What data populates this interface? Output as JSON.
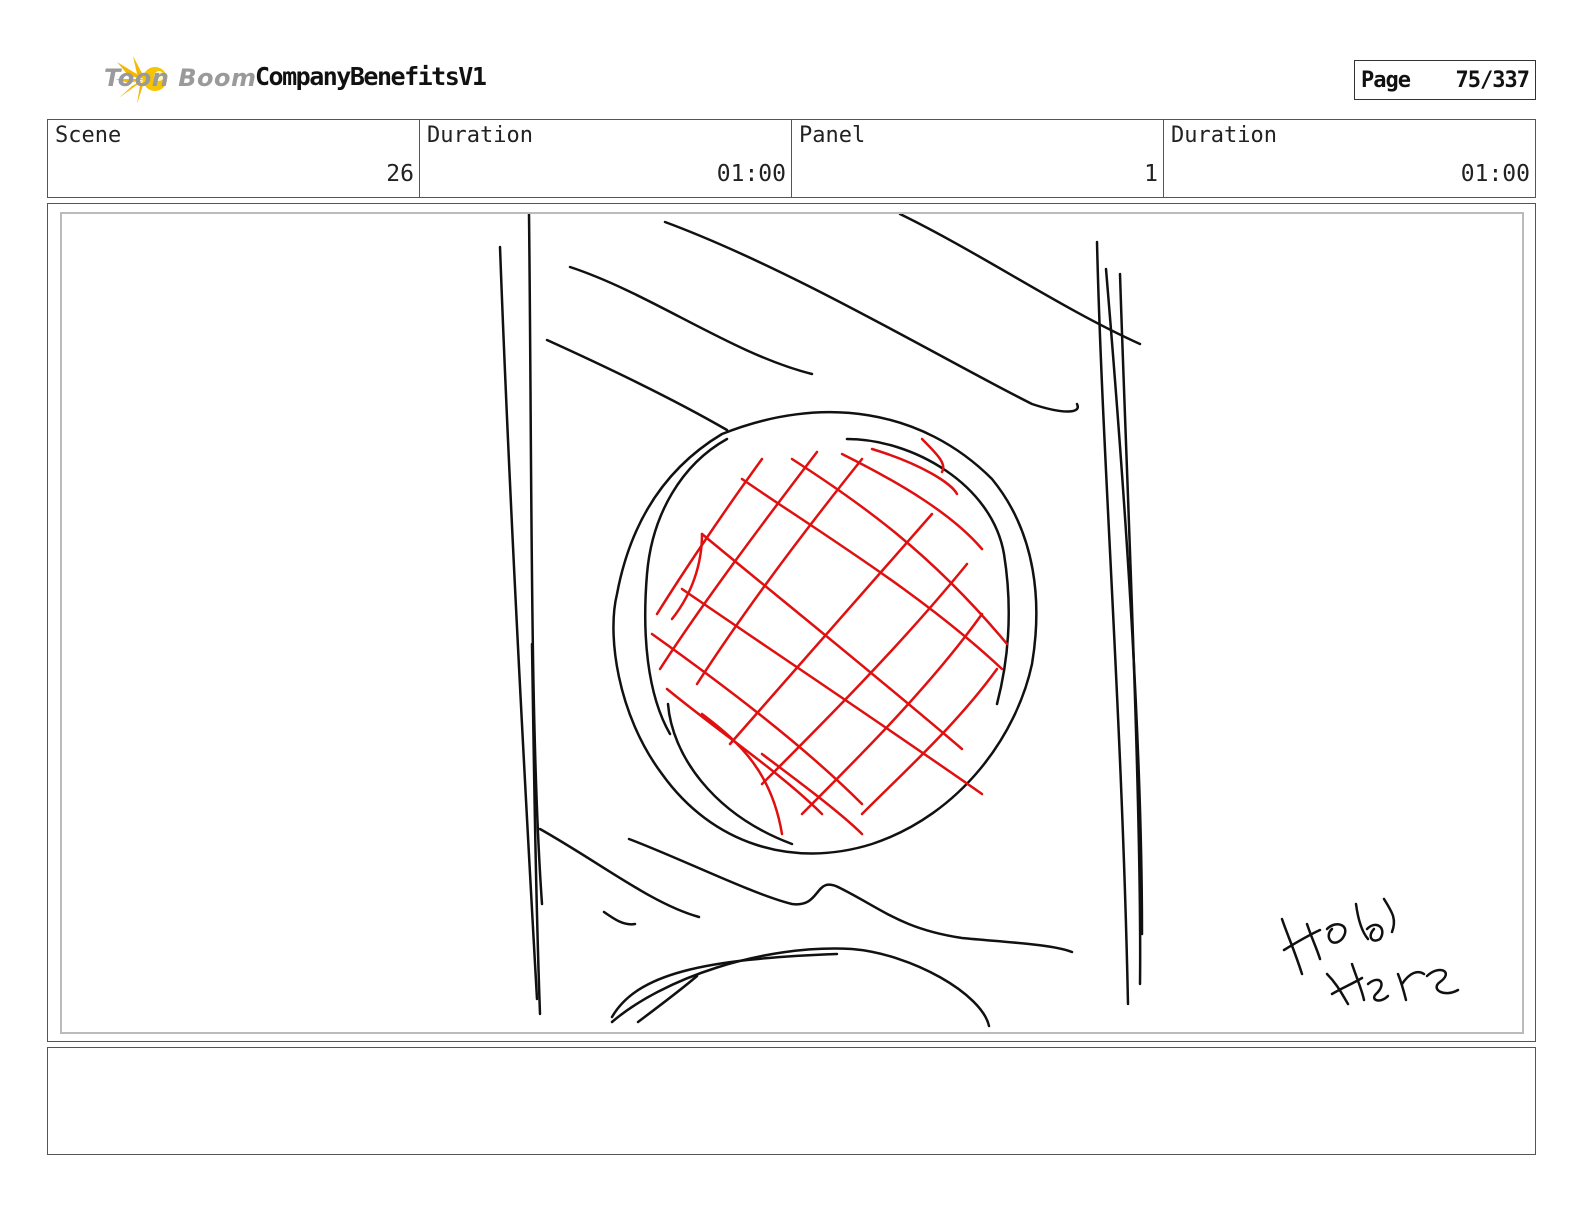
{
  "header": {
    "brand": "Toon Boom",
    "project_title": "CompanyBenefitsV1",
    "page_label": "Page",
    "page_number": "75/337"
  },
  "info": {
    "scene_label": "Scene",
    "scene_value": "26",
    "scene_duration_label": "Duration",
    "scene_duration_value": "01:00",
    "panel_label": "Panel",
    "panel_value": "1",
    "panel_duration_label": "Duration",
    "panel_duration_value": "01:00"
  },
  "panel": {
    "handwritten_note": "Hold Here",
    "colors": {
      "ink": "#111111",
      "highlight": "#e01010"
    }
  },
  "notes": {
    "text": ""
  }
}
